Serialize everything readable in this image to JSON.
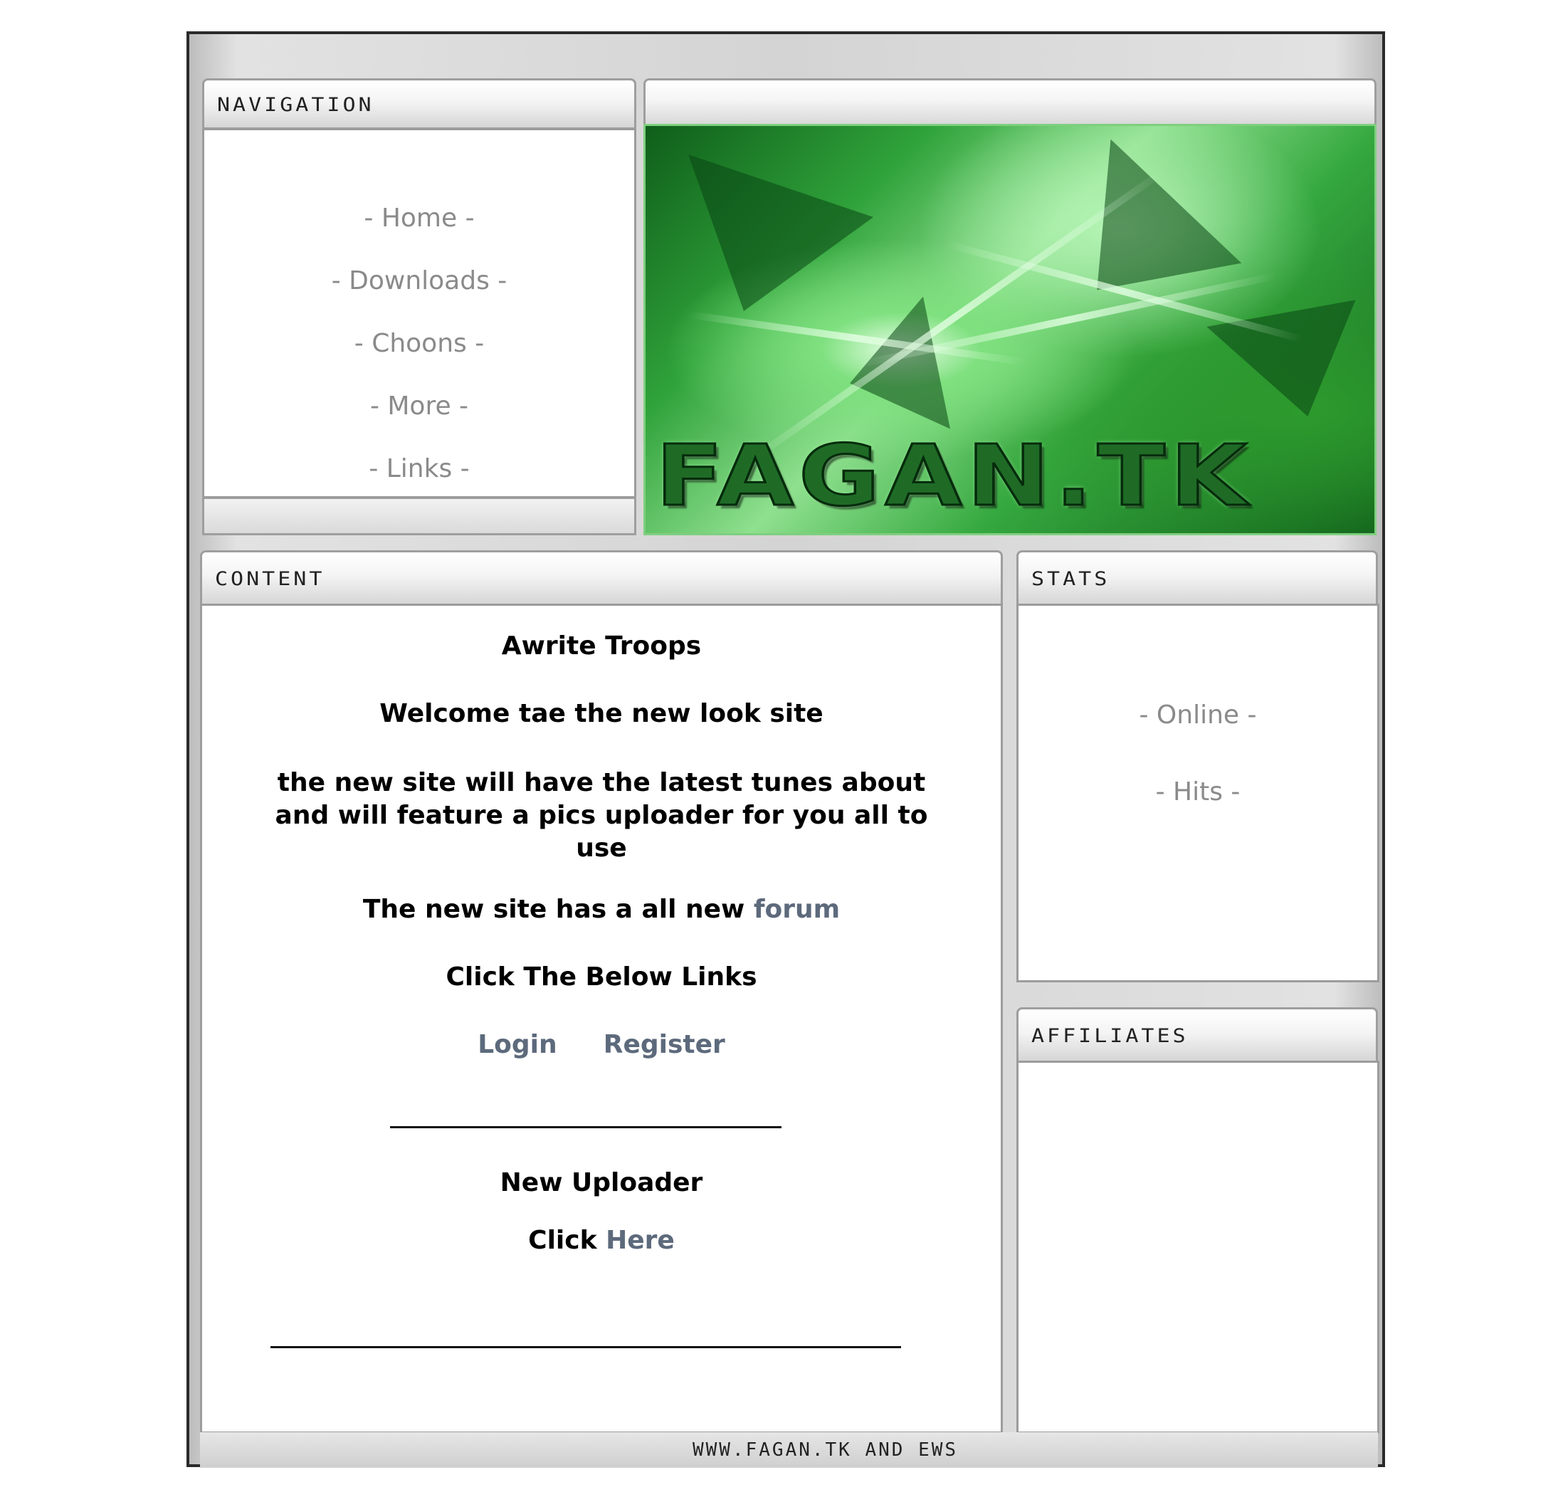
{
  "navigation": {
    "title": "NAVIGATION",
    "items": [
      {
        "label": "- Home -"
      },
      {
        "label": "- Downloads -"
      },
      {
        "label": "- Choons -"
      },
      {
        "label": "- More -"
      },
      {
        "label": "- Links -"
      }
    ]
  },
  "banner": {
    "logo_text": "FAGAN.TK",
    "accent_color": "#2fa23a"
  },
  "content": {
    "title": "CONTENT",
    "heading": "Awrite Troops",
    "welcome": "Welcome tae the new look site",
    "description": "the new site will have the latest tunes about and will feature a pics uploader for you all to use",
    "forum_prefix": "The new site has a all new ",
    "forum_link": "forum",
    "click_links": "Click The Below Links",
    "login_link": "Login",
    "register_link": "Register",
    "uploader_heading": "New Uploader",
    "click_prefix": "Click ",
    "here_link": "Here",
    "link_color": "#5d6a7c"
  },
  "stats": {
    "title": "STATS",
    "items": [
      {
        "label": "-   Online -"
      },
      {
        "label": "-   Hits -"
      }
    ]
  },
  "affiliates": {
    "title": "AFFILIATES"
  },
  "footer": {
    "text": "WWW.FAGAN.TK AND EWS"
  }
}
